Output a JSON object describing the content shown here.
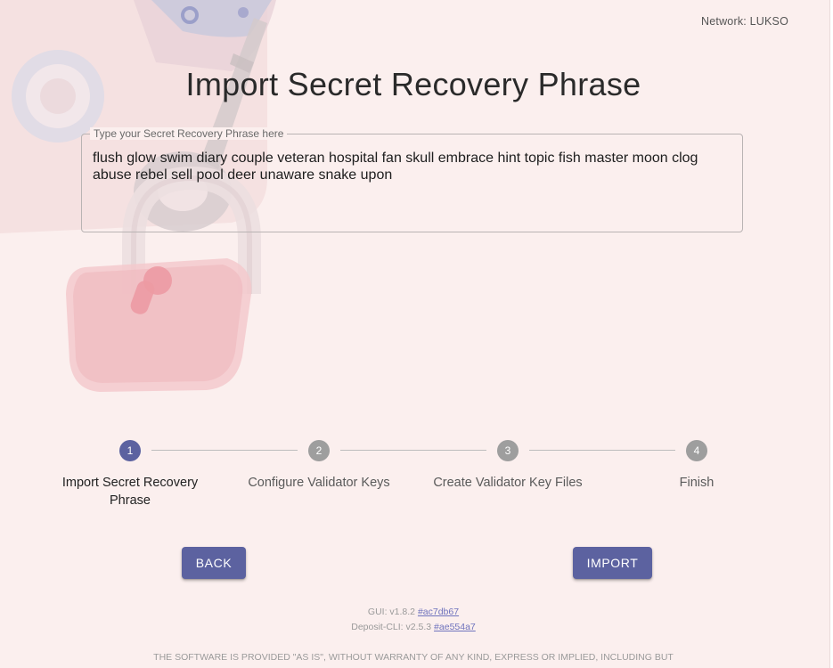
{
  "network": {
    "label": "Network: LUKSO"
  },
  "page": {
    "title": "Import Secret Recovery Phrase"
  },
  "phrase_input": {
    "label": "Type your Secret Recovery Phrase here",
    "value": "flush glow swim diary couple veteran hospital fan skull embrace hint topic fish master moon clog abuse rebel sell pool deer unaware snake upon"
  },
  "stepper": {
    "active_step": 1,
    "steps": [
      {
        "number": "1",
        "label": "Import Secret Recovery Phrase"
      },
      {
        "number": "2",
        "label": "Configure Validator Keys"
      },
      {
        "number": "3",
        "label": "Create Validator Key Files"
      },
      {
        "number": "4",
        "label": "Finish"
      }
    ]
  },
  "actions": {
    "back_label": "BACK",
    "import_label": "IMPORT"
  },
  "footer": {
    "gui_prefix": "GUI: v1.8.2",
    "gui_hash": "#ac7db67",
    "cli_prefix": "Deposit-CLI: v2.5.3",
    "cli_hash": "#ae554a7",
    "license_text": "THE SOFTWARE IS PROVIDED \"AS IS\", WITHOUT WARRANTY OF ANY KIND, EXPRESS OR IMPLIED, INCLUDING BUT"
  },
  "colors": {
    "background": "#fbefee",
    "accent": "#5c62a0",
    "inactive_step": "#9e9e9e"
  },
  "icons": {
    "background_art": "padlock-and-key-illustration"
  }
}
